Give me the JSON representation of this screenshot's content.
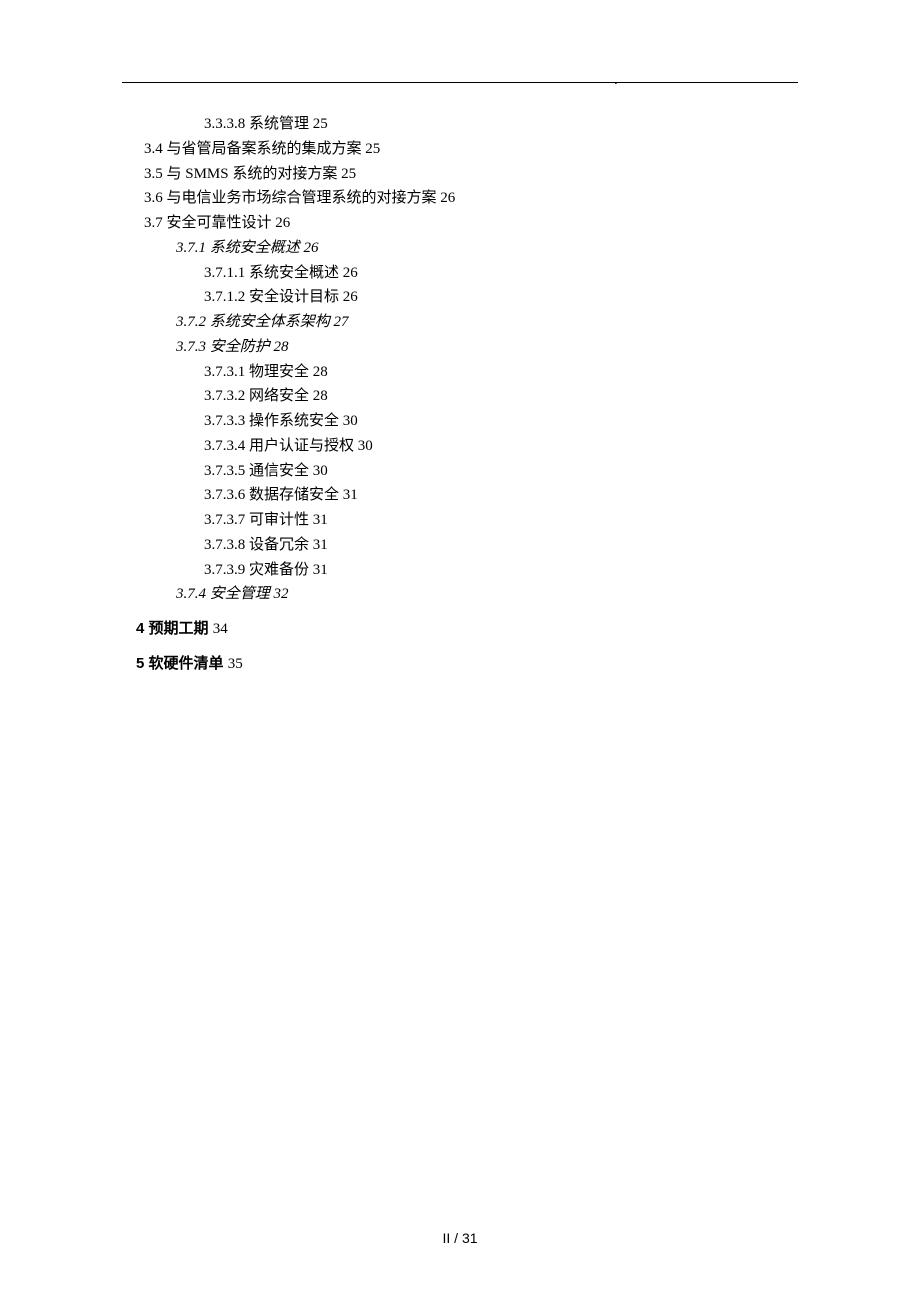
{
  "toc": {
    "i0": {
      "num": "3.3.3.8",
      "label": "系统管理",
      "page": "25"
    },
    "i1": {
      "num": "3.4",
      "label": "与省管局备案系统的集成方案",
      "page": "25"
    },
    "i2": {
      "num": "3.5",
      "label": "与 SMMS 系统的对接方案",
      "page": "25"
    },
    "i3": {
      "num": "3.6",
      "label": "与电信业务市场综合管理系统的对接方案",
      "page": "26"
    },
    "i4": {
      "num": "3.7",
      "label": "安全可靠性设计",
      "page": "26"
    },
    "i5": {
      "num": "3.7.1",
      "label": "系统安全概述",
      "page": "26"
    },
    "i6": {
      "num": "3.7.1.1",
      "label": "系统安全概述",
      "page": "26"
    },
    "i7": {
      "num": "3.7.1.2",
      "label": "安全设计目标",
      "page": "26"
    },
    "i8": {
      "num": "3.7.2",
      "label": "系统安全体系架构",
      "page": "27"
    },
    "i9": {
      "num": "3.7.3",
      "label": "安全防护",
      "page": "28"
    },
    "i10": {
      "num": "3.7.3.1",
      "label": "物理安全",
      "page": "28"
    },
    "i11": {
      "num": "3.7.3.2",
      "label": "网络安全",
      "page": "28"
    },
    "i12": {
      "num": "3.7.3.3",
      "label": "操作系统安全",
      "page": "30"
    },
    "i13": {
      "num": "3.7.3.4",
      "label": "用户认证与授权",
      "page": "30"
    },
    "i14": {
      "num": "3.7.3.5",
      "label": "通信安全",
      "page": "30"
    },
    "i15": {
      "num": "3.7.3.6",
      "label": "数据存储安全",
      "page": "31"
    },
    "i16": {
      "num": "3.7.3.7",
      "label": "可审计性",
      "page": "31"
    },
    "i17": {
      "num": "3.7.3.8",
      "label": "设备冗余",
      "page": "31"
    },
    "i18": {
      "num": "3.7.3.9",
      "label": "灾难备份",
      "page": "31"
    },
    "i19": {
      "num": "3.7.4",
      "label": "安全管理",
      "page": "32"
    },
    "i20": {
      "num": "4",
      "label": "预期工期",
      "page": "34"
    },
    "i21": {
      "num": "5",
      "label": "软硬件清单",
      "page": "35"
    }
  },
  "footer": {
    "roman": "II",
    "sep": " / ",
    "total": "31"
  }
}
